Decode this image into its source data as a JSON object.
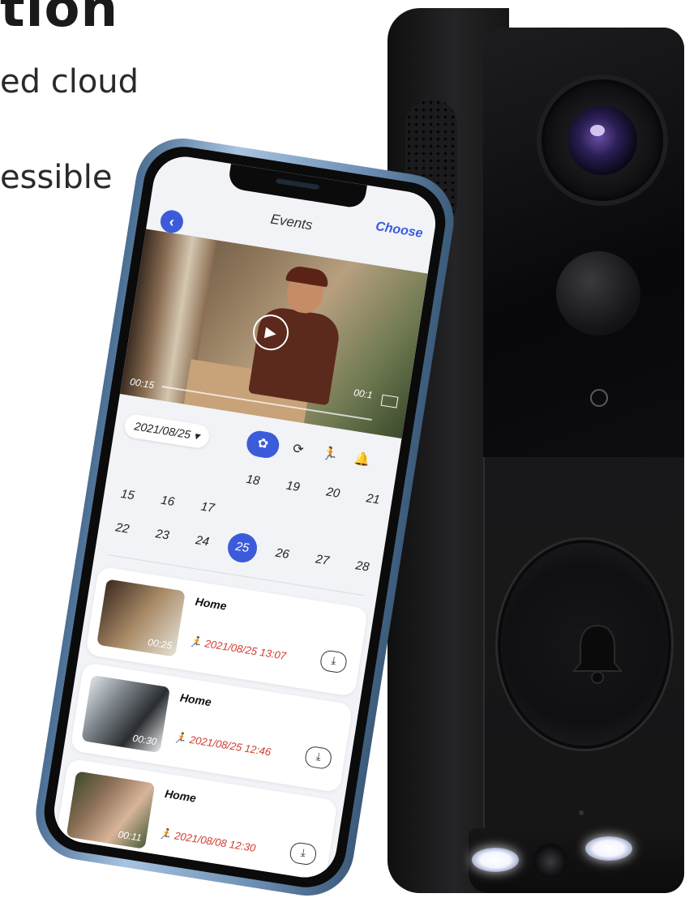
{
  "marketing": {
    "headline_fragment": "tion",
    "line1_fragment": "ed cloud",
    "line2_fragment": "essible"
  },
  "app": {
    "title": "Events",
    "choose_label": "Choose",
    "back_label": "‹",
    "player": {
      "time_left": "00:15",
      "time_right": "00:1",
      "play_glyph": "▶"
    },
    "date_selector": "2021/08/25 ▾",
    "filter_icons": [
      "all-events-icon",
      "replay-icon",
      "motion-icon",
      "bell-icon"
    ],
    "calendar": {
      "rows": [
        [
          "",
          "",
          "",
          "18",
          "19",
          "20",
          "21"
        ],
        [
          "15",
          "16",
          "17",
          "",
          "",
          "",
          ""
        ],
        [
          "22",
          "23",
          "24",
          "25",
          "26",
          "27",
          "28"
        ]
      ],
      "selected": "25"
    },
    "events": [
      {
        "title": "Home",
        "time": "2021/08/25 13:07",
        "duration": "00:25"
      },
      {
        "title": "Home",
        "time": "2021/08/25 12:46",
        "duration": "00:30"
      },
      {
        "title": "Home",
        "time": "2021/08/08 12:30",
        "duration": "00:11"
      }
    ]
  },
  "colors": {
    "accent": "#3b5bdb",
    "event_time": "#d03a2f",
    "device_body": "#151516"
  }
}
